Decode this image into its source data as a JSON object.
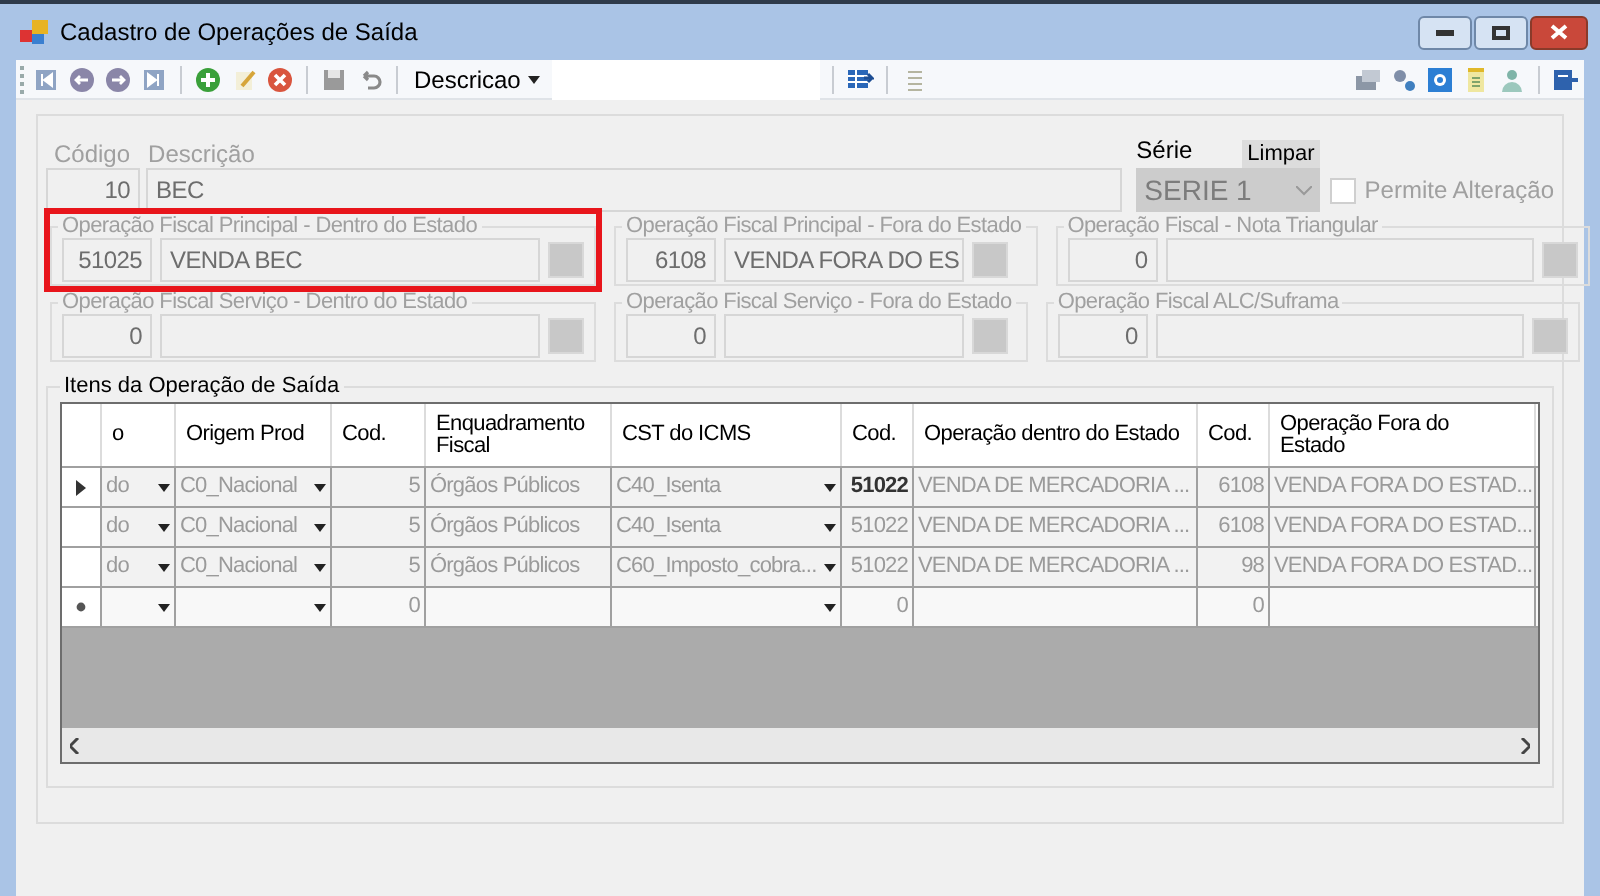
{
  "window": {
    "title": "Cadastro de Operações de Saída"
  },
  "toolbar": {
    "search_by": "Descricao"
  },
  "form": {
    "codigo": {
      "label": "Código",
      "value": "10"
    },
    "descricao": {
      "label": "Descrição",
      "value": "BEC"
    },
    "serie": {
      "label": "Série",
      "value": "SERIE 1"
    },
    "limpar": "Limpar",
    "permite_alteracao": {
      "label": "Permite Alteração",
      "checked": false
    }
  },
  "groups": [
    {
      "title": "Operação Fiscal Principal - Dentro do Estado",
      "code": "51025",
      "description": "VENDA BEC",
      "highlighted": true
    },
    {
      "title": "Operação Fiscal Principal - Fora do Estado",
      "code": "6108",
      "description": "VENDA FORA DO ES",
      "highlighted": false
    },
    {
      "title": "Operação Fiscal - Nota Triangular",
      "code": "0",
      "highlighted": false
    },
    {
      "title": "Operação Fiscal Serviço - Dentro do Estado",
      "code": "0",
      "highlighted": false
    },
    {
      "title": "Operação Fiscal Serviço - Fora do Estado",
      "code": "0",
      "highlighted": false
    },
    {
      "title": "Operação Fiscal ALC/Suframa",
      "code": "0",
      "highlighted": false
    }
  ],
  "items": {
    "title": "Itens da Operação de Saída",
    "columns": [
      {
        "label": "o",
        "kind": "combo"
      },
      {
        "label": "Origem Prod",
        "kind": "combo"
      },
      {
        "label": "Cod.",
        "kind": "number"
      },
      {
        "label": "Enquadramento Fiscal",
        "kind": "text"
      },
      {
        "label": "CST do ICMS",
        "kind": "combo"
      },
      {
        "label": "Cod.",
        "kind": "number"
      },
      {
        "label": "Operação dentro do Estado",
        "kind": "text"
      },
      {
        "label": "Cod.",
        "kind": "number"
      },
      {
        "label": "Operação Fora do Estado",
        "kind": "text"
      }
    ],
    "rows": [
      {
        "kind": "data",
        "selected": true,
        "cells": [
          {
            "text": "do"
          },
          {
            "text": "C0_Nacional"
          },
          {
            "text": "5"
          },
          {
            "text": "Órgãos Públicos"
          },
          {
            "text": "C40_Isenta"
          },
          {
            "text": "51022",
            "focused": true
          },
          {
            "text": "VENDA DE MERCADORIA ..."
          },
          {
            "text": "6108"
          },
          {
            "text": "VENDA FORA DO ESTAD..."
          }
        ]
      },
      {
        "kind": "data",
        "selected": false,
        "cells": [
          {
            "text": "do"
          },
          {
            "text": "C0_Nacional"
          },
          {
            "text": "5"
          },
          {
            "text": "Órgãos Públicos"
          },
          {
            "text": "C40_Isenta"
          },
          {
            "text": "51022"
          },
          {
            "text": "VENDA DE MERCADORIA ..."
          },
          {
            "text": "6108"
          },
          {
            "text": "VENDA FORA DO ESTAD..."
          }
        ]
      },
      {
        "kind": "data",
        "selected": false,
        "cells": [
          {
            "text": "do"
          },
          {
            "text": "C0_Nacional"
          },
          {
            "text": "5"
          },
          {
            "text": "Órgãos Públicos"
          },
          {
            "text": "C60_Imposto_cobra..."
          },
          {
            "text": "51022"
          },
          {
            "text": "VENDA DE MERCADORIA ..."
          },
          {
            "text": "98"
          },
          {
            "text": "VENDA FORA DO ESTAD..."
          }
        ]
      },
      {
        "kind": "new",
        "selected": false,
        "cells": [
          {},
          {},
          {
            "text": "0"
          },
          {},
          {},
          {
            "text": "0"
          },
          {},
          {
            "text": "0"
          },
          {}
        ]
      }
    ]
  }
}
